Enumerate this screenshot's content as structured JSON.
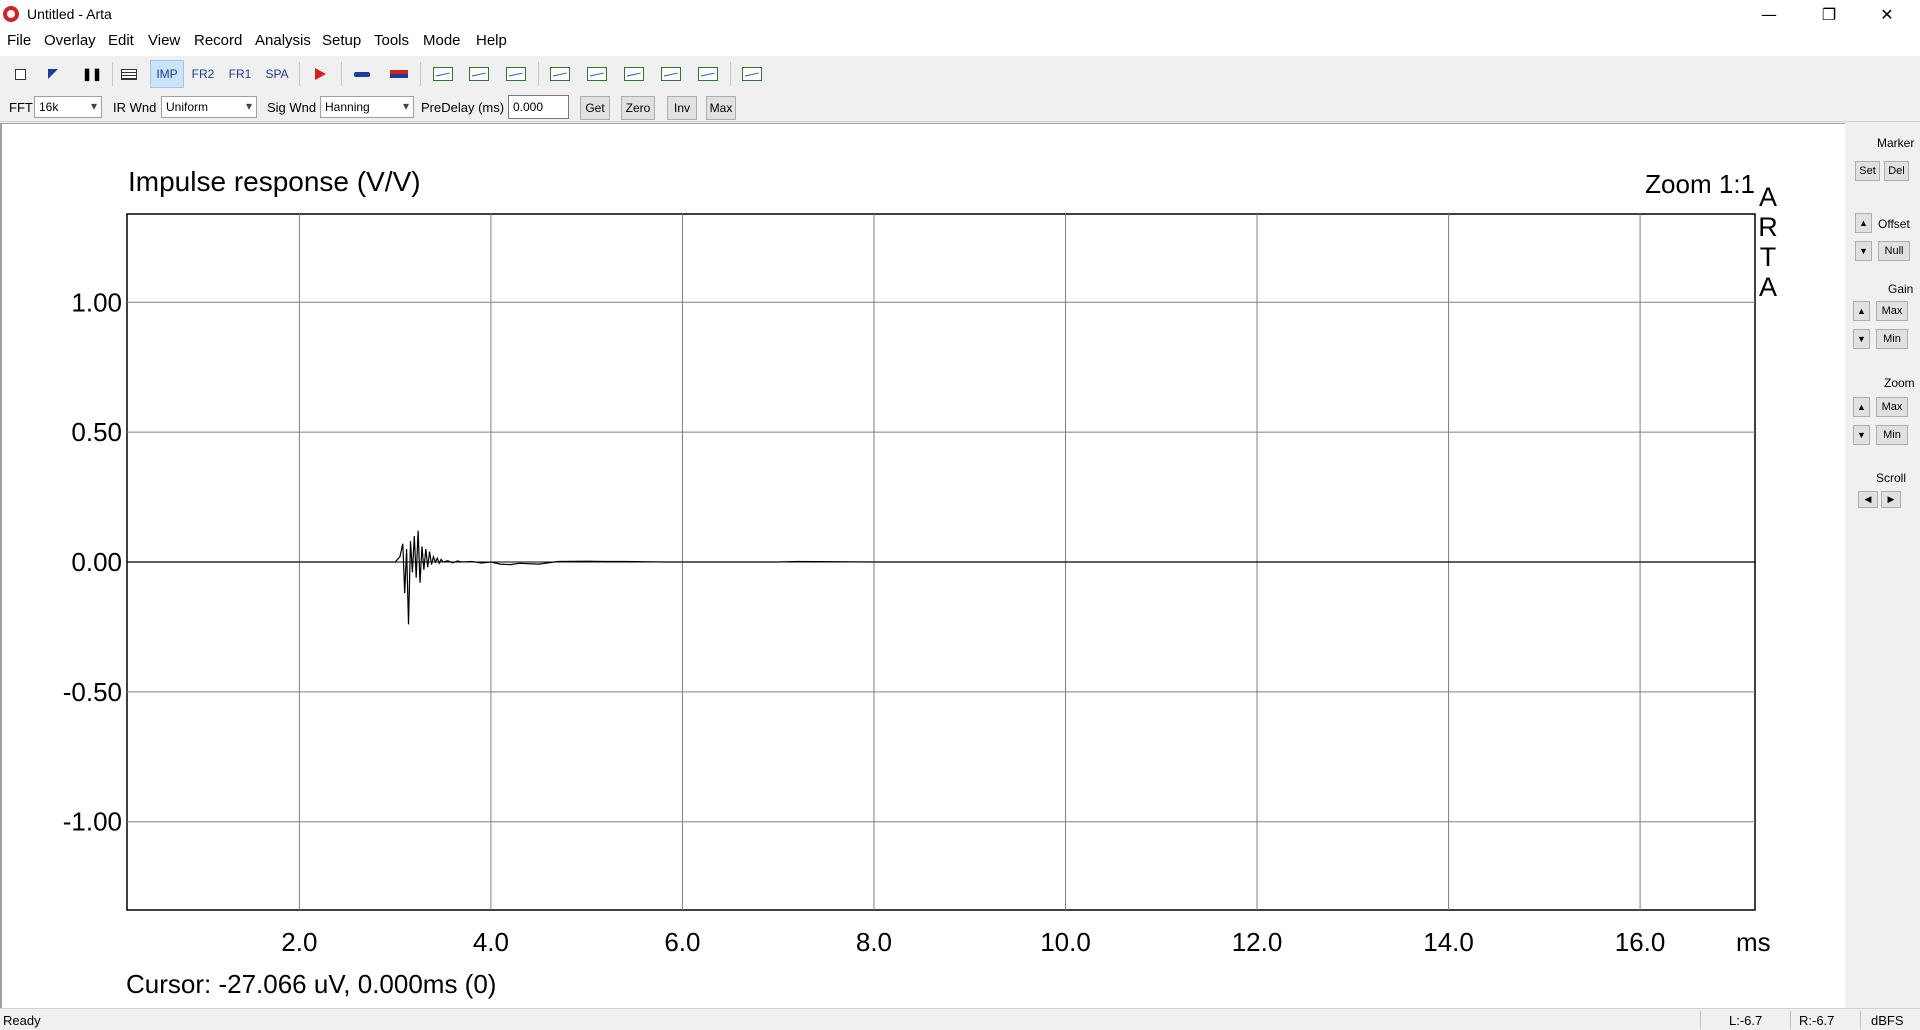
{
  "window": {
    "title": "Untitled - Arta",
    "minimize_icon": "minimize-icon",
    "maximize_icon": "restore-icon",
    "close_icon": "close-icon"
  },
  "menu": [
    "File",
    "Overlay",
    "Edit",
    "View",
    "Record",
    "Analysis",
    "Setup",
    "Tools",
    "Mode",
    "Help"
  ],
  "toolbar": {
    "imp": "IMP",
    "fr2": "FR2",
    "fr1": "FR1",
    "spa": "SPA"
  },
  "options": {
    "fft_label": "FFT",
    "fft_value": "16k",
    "irwnd_label": "IR Wnd",
    "irwnd_value": "Uniform",
    "sigwnd_label": "Sig Wnd",
    "sigwnd_value": "Hanning",
    "predelay_label": "PreDelay (ms)",
    "predelay_value": "0.000",
    "get": "Get",
    "zero": "Zero",
    "inv": "Inv",
    "max": "Max"
  },
  "side": {
    "marker": "Marker",
    "set": "Set",
    "del": "Del",
    "offset": "Offset",
    "null": "Null",
    "gain": "Gain",
    "gain_max": "Max",
    "gain_min": "Min",
    "zoom": "Zoom",
    "zoom_max": "Max",
    "zoom_min": "Min",
    "scroll": "Scroll"
  },
  "status": {
    "ready": "Ready",
    "left": "L:-6.7",
    "right": "R:-6.7",
    "unit": "dBFS"
  },
  "chart_data": {
    "type": "line",
    "title": "Impulse response (V/V)",
    "zoom": "Zoom 1:1",
    "brand": "ARTA",
    "xlabel": "ms",
    "xlim": [
      0.2,
      17.2
    ],
    "ylim": [
      -1.34,
      1.34
    ],
    "xticks": [
      "2.0",
      "4.0",
      "6.0",
      "8.0",
      "10.0",
      "12.0",
      "14.0",
      "16.0"
    ],
    "yticks": [
      "1.00",
      "0.50",
      "0.00",
      "-0.50",
      "-1.00"
    ],
    "cursor_text": "Cursor: -27.066 uV, 0.000ms (0)",
    "series": [
      {
        "x": [
          0.2,
          3.0,
          3.05,
          3.08,
          3.1,
          3.12,
          3.14,
          3.16,
          3.18,
          3.2,
          3.22,
          3.24,
          3.26,
          3.28,
          3.3,
          3.32,
          3.34,
          3.36,
          3.38,
          3.4,
          3.42,
          3.44,
          3.46,
          3.48,
          3.5,
          3.55,
          3.6,
          3.65,
          3.7,
          3.8,
          3.9,
          4.0,
          4.1,
          4.2,
          4.3,
          4.5,
          4.7,
          5.0,
          5.2,
          5.4,
          5.6,
          5.8,
          6.0,
          7.0,
          7.2,
          8.0,
          16.0,
          17.2
        ],
        "y": [
          0.0,
          0.0,
          0.02,
          0.07,
          -0.12,
          0.05,
          -0.24,
          0.08,
          -0.04,
          0.1,
          -0.06,
          0.12,
          -0.08,
          0.06,
          -0.03,
          0.05,
          -0.02,
          0.04,
          -0.01,
          0.02,
          0.0,
          0.015,
          -0.005,
          0.01,
          0.0,
          0.005,
          -0.003,
          0.004,
          0.0,
          0.002,
          -0.004,
          0.0,
          -0.008,
          -0.01,
          -0.005,
          -0.008,
          0.002,
          0.003,
          0.002,
          0.002,
          0.001,
          0.0,
          0.0,
          0.0,
          0.002,
          0.0,
          0.0,
          0.0
        ]
      }
    ]
  }
}
